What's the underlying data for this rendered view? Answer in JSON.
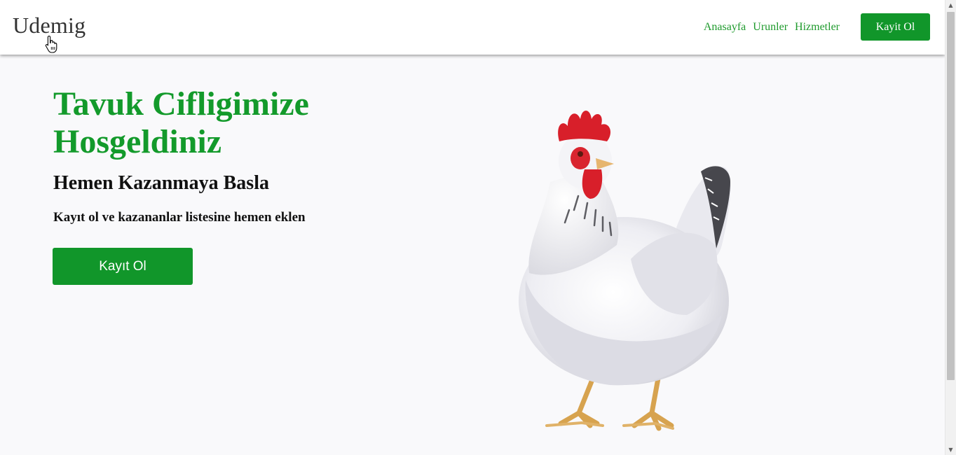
{
  "navbar": {
    "brand": "Udemig",
    "links": [
      "Anasayfa",
      "Urunler",
      "Hizmetler"
    ],
    "cta_label": "Kayit Ol"
  },
  "hero": {
    "title": "Tavuk Cifligimize Hosgeldiniz",
    "subtitle": "Hemen Kazanmaya Basla",
    "text": "Kayıt ol ve kazananlar listesine hemen eklen",
    "cta_label": "Kayıt Ol"
  },
  "colors": {
    "accent_green": "#11962a",
    "title_green": "#139a2b",
    "nav_link_green": "#1e9a2c",
    "text_dark": "#111111"
  },
  "icons": {
    "cursor": "hand-pointer-icon",
    "scroll_up": "scroll-up-arrow-icon",
    "scroll_down": "scroll-down-arrow-icon"
  }
}
